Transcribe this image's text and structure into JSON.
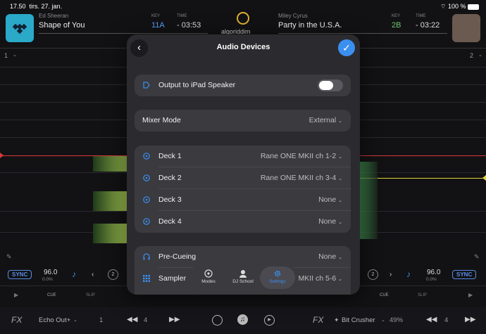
{
  "status": {
    "time": "17.50",
    "date": "tirs. 27. jan.",
    "battery": "100 %"
  },
  "deck_left": {
    "artist": "Ed Sheeran",
    "title": "Shape of You",
    "key_label": "KEY",
    "key": "11A",
    "time_label": "TIME",
    "time": "- 03:53",
    "number": "1",
    "key_color": "#5aa2ff"
  },
  "deck_right": {
    "artist": "Miley Cyrus",
    "title": "Party in the U.S.A.",
    "key_label": "KEY",
    "key": "2B",
    "time_label": "TIME",
    "time": "- 03:22",
    "number": "2",
    "key_color": "#6cc86c"
  },
  "logo": {
    "text": "algoriddim"
  },
  "modal": {
    "title": "Audio Devices",
    "output": {
      "label": "Output to iPad Speaker",
      "enabled": false
    },
    "mixer": {
      "label": "Mixer Mode",
      "value": "External"
    },
    "decks": [
      {
        "label": "Deck 1",
        "value": "Rane ONE MKII ch 1-2"
      },
      {
        "label": "Deck 2",
        "value": "Rane ONE MKII ch 3-4"
      },
      {
        "label": "Deck 3",
        "value": "None"
      },
      {
        "label": "Deck 4",
        "value": "None"
      }
    ],
    "precue": {
      "label": "Pre-Cueing",
      "value": "None"
    },
    "sampler": {
      "label": "Sampler",
      "value": "MKII ch 5-6"
    }
  },
  "tabs": [
    {
      "label": "Modes",
      "icon": "modes-icon"
    },
    {
      "label": "DJ School",
      "icon": "dj-school-icon"
    },
    {
      "label": "Settings",
      "icon": "gear-icon",
      "active": true
    }
  ],
  "controls_left": {
    "sync": "SYNC",
    "bpm": "96.0",
    "pitch": "0.0%",
    "cue": "CUE",
    "slip": "SLIP",
    "loop": "2"
  },
  "controls_right": {
    "sync": "SYNC",
    "bpm": "96.0",
    "pitch": "0.0%",
    "cue": "CUE",
    "slip": "SLIP",
    "loop": "2"
  },
  "fx_left": {
    "label": "FX",
    "effect": "Echo Out+",
    "value": "1",
    "beats": "4"
  },
  "fx_right": {
    "label": "FX",
    "effect": "Bit Crusher",
    "value": "49%",
    "beats": "4"
  },
  "colors": {
    "accent": "#3b8ff0",
    "cue_red": "#d9383a",
    "cue_yellow": "#e3d23a"
  }
}
